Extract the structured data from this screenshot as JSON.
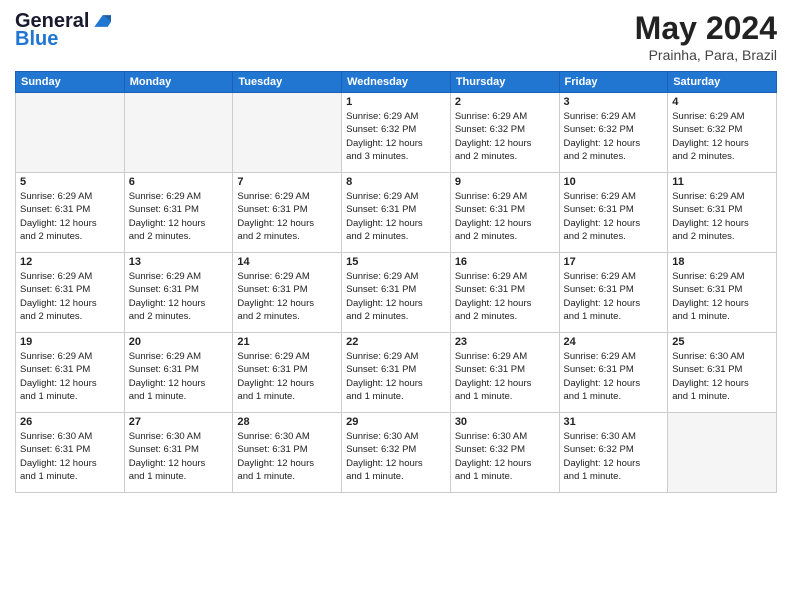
{
  "header": {
    "logo_line1": "General",
    "logo_line2": "Blue",
    "month_title": "May 2024",
    "location": "Prainha, Para, Brazil"
  },
  "weekdays": [
    "Sunday",
    "Monday",
    "Tuesday",
    "Wednesday",
    "Thursday",
    "Friday",
    "Saturday"
  ],
  "weeks": [
    [
      {
        "day": "",
        "info": "",
        "empty": true
      },
      {
        "day": "",
        "info": "",
        "empty": true
      },
      {
        "day": "",
        "info": "",
        "empty": true
      },
      {
        "day": "1",
        "info": "Sunrise: 6:29 AM\nSunset: 6:32 PM\nDaylight: 12 hours\nand 3 minutes.",
        "empty": false
      },
      {
        "day": "2",
        "info": "Sunrise: 6:29 AM\nSunset: 6:32 PM\nDaylight: 12 hours\nand 2 minutes.",
        "empty": false
      },
      {
        "day": "3",
        "info": "Sunrise: 6:29 AM\nSunset: 6:32 PM\nDaylight: 12 hours\nand 2 minutes.",
        "empty": false
      },
      {
        "day": "4",
        "info": "Sunrise: 6:29 AM\nSunset: 6:32 PM\nDaylight: 12 hours\nand 2 minutes.",
        "empty": false
      }
    ],
    [
      {
        "day": "5",
        "info": "Sunrise: 6:29 AM\nSunset: 6:31 PM\nDaylight: 12 hours\nand 2 minutes.",
        "empty": false
      },
      {
        "day": "6",
        "info": "Sunrise: 6:29 AM\nSunset: 6:31 PM\nDaylight: 12 hours\nand 2 minutes.",
        "empty": false
      },
      {
        "day": "7",
        "info": "Sunrise: 6:29 AM\nSunset: 6:31 PM\nDaylight: 12 hours\nand 2 minutes.",
        "empty": false
      },
      {
        "day": "8",
        "info": "Sunrise: 6:29 AM\nSunset: 6:31 PM\nDaylight: 12 hours\nand 2 minutes.",
        "empty": false
      },
      {
        "day": "9",
        "info": "Sunrise: 6:29 AM\nSunset: 6:31 PM\nDaylight: 12 hours\nand 2 minutes.",
        "empty": false
      },
      {
        "day": "10",
        "info": "Sunrise: 6:29 AM\nSunset: 6:31 PM\nDaylight: 12 hours\nand 2 minutes.",
        "empty": false
      },
      {
        "day": "11",
        "info": "Sunrise: 6:29 AM\nSunset: 6:31 PM\nDaylight: 12 hours\nand 2 minutes.",
        "empty": false
      }
    ],
    [
      {
        "day": "12",
        "info": "Sunrise: 6:29 AM\nSunset: 6:31 PM\nDaylight: 12 hours\nand 2 minutes.",
        "empty": false
      },
      {
        "day": "13",
        "info": "Sunrise: 6:29 AM\nSunset: 6:31 PM\nDaylight: 12 hours\nand 2 minutes.",
        "empty": false
      },
      {
        "day": "14",
        "info": "Sunrise: 6:29 AM\nSunset: 6:31 PM\nDaylight: 12 hours\nand 2 minutes.",
        "empty": false
      },
      {
        "day": "15",
        "info": "Sunrise: 6:29 AM\nSunset: 6:31 PM\nDaylight: 12 hours\nand 2 minutes.",
        "empty": false
      },
      {
        "day": "16",
        "info": "Sunrise: 6:29 AM\nSunset: 6:31 PM\nDaylight: 12 hours\nand 2 minutes.",
        "empty": false
      },
      {
        "day": "17",
        "info": "Sunrise: 6:29 AM\nSunset: 6:31 PM\nDaylight: 12 hours\nand 1 minute.",
        "empty": false
      },
      {
        "day": "18",
        "info": "Sunrise: 6:29 AM\nSunset: 6:31 PM\nDaylight: 12 hours\nand 1 minute.",
        "empty": false
      }
    ],
    [
      {
        "day": "19",
        "info": "Sunrise: 6:29 AM\nSunset: 6:31 PM\nDaylight: 12 hours\nand 1 minute.",
        "empty": false
      },
      {
        "day": "20",
        "info": "Sunrise: 6:29 AM\nSunset: 6:31 PM\nDaylight: 12 hours\nand 1 minute.",
        "empty": false
      },
      {
        "day": "21",
        "info": "Sunrise: 6:29 AM\nSunset: 6:31 PM\nDaylight: 12 hours\nand 1 minute.",
        "empty": false
      },
      {
        "day": "22",
        "info": "Sunrise: 6:29 AM\nSunset: 6:31 PM\nDaylight: 12 hours\nand 1 minute.",
        "empty": false
      },
      {
        "day": "23",
        "info": "Sunrise: 6:29 AM\nSunset: 6:31 PM\nDaylight: 12 hours\nand 1 minute.",
        "empty": false
      },
      {
        "day": "24",
        "info": "Sunrise: 6:29 AM\nSunset: 6:31 PM\nDaylight: 12 hours\nand 1 minute.",
        "empty": false
      },
      {
        "day": "25",
        "info": "Sunrise: 6:30 AM\nSunset: 6:31 PM\nDaylight: 12 hours\nand 1 minute.",
        "empty": false
      }
    ],
    [
      {
        "day": "26",
        "info": "Sunrise: 6:30 AM\nSunset: 6:31 PM\nDaylight: 12 hours\nand 1 minute.",
        "empty": false
      },
      {
        "day": "27",
        "info": "Sunrise: 6:30 AM\nSunset: 6:31 PM\nDaylight: 12 hours\nand 1 minute.",
        "empty": false
      },
      {
        "day": "28",
        "info": "Sunrise: 6:30 AM\nSunset: 6:31 PM\nDaylight: 12 hours\nand 1 minute.",
        "empty": false
      },
      {
        "day": "29",
        "info": "Sunrise: 6:30 AM\nSunset: 6:32 PM\nDaylight: 12 hours\nand 1 minute.",
        "empty": false
      },
      {
        "day": "30",
        "info": "Sunrise: 6:30 AM\nSunset: 6:32 PM\nDaylight: 12 hours\nand 1 minute.",
        "empty": false
      },
      {
        "day": "31",
        "info": "Sunrise: 6:30 AM\nSunset: 6:32 PM\nDaylight: 12 hours\nand 1 minute.",
        "empty": false
      },
      {
        "day": "",
        "info": "",
        "empty": true
      }
    ]
  ]
}
